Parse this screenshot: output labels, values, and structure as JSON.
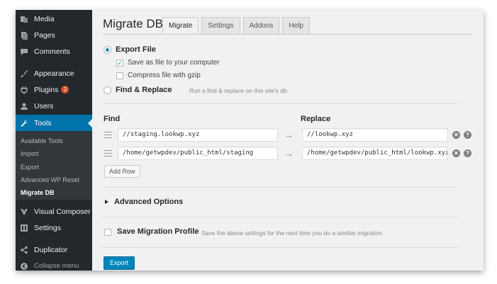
{
  "sidebar": {
    "items": [
      {
        "label": "Media",
        "icon": "media-icon"
      },
      {
        "label": "Pages",
        "icon": "pages-icon"
      },
      {
        "label": "Comments",
        "icon": "comments-icon"
      },
      {
        "label": "Appearance",
        "icon": "appearance-icon"
      },
      {
        "label": "Plugins",
        "icon": "plugins-icon",
        "badge": "2"
      },
      {
        "label": "Users",
        "icon": "users-icon"
      },
      {
        "label": "Tools",
        "icon": "tools-icon"
      }
    ],
    "submenu": [
      "Available Tools",
      "Import",
      "Export",
      "Advanced WP Reset",
      "Migrate DB"
    ],
    "bottom_items": [
      {
        "label": "Visual Composer",
        "icon": "visual-composer-icon"
      },
      {
        "label": "Settings",
        "icon": "settings-icon"
      },
      {
        "label": "Duplicator",
        "icon": "duplicator-icon"
      }
    ],
    "collapse_label": "Collapse menu",
    "accent_color": "#0073aa",
    "badge_color": "#d54e21"
  },
  "page": {
    "title": "Migrate DB",
    "tabs": [
      "Migrate",
      "Settings",
      "Addons",
      "Help"
    ],
    "active_tab": "Migrate"
  },
  "options": {
    "export_file_label": "Export File",
    "save_as_file_label": "Save as file to your computer",
    "compress_label": "Compress file with gzip",
    "find_replace_label": "Find & Replace",
    "find_replace_hint": "Run a find & replace on this site's db"
  },
  "find_replace": {
    "find_header": "Find",
    "replace_header": "Replace",
    "rows": [
      {
        "find": "//staging.lookwp.xyz",
        "replace": "//lookwp.xyz"
      },
      {
        "find": "/home/getwpdev/public_html/staging",
        "replace": "/home/getwpdev/public_html/lookwp.xyz"
      }
    ],
    "add_row_label": "Add Row",
    "arrow_glyph": "→",
    "remove_glyph": "✕",
    "help_glyph": "?"
  },
  "advanced": {
    "label": "Advanced Options"
  },
  "profile": {
    "label": "Save Migration Profile",
    "hint": "Save the above settings for the next time you do a similiar migration"
  },
  "export_button_label": "Export",
  "primary_button_color": "#0085ba"
}
